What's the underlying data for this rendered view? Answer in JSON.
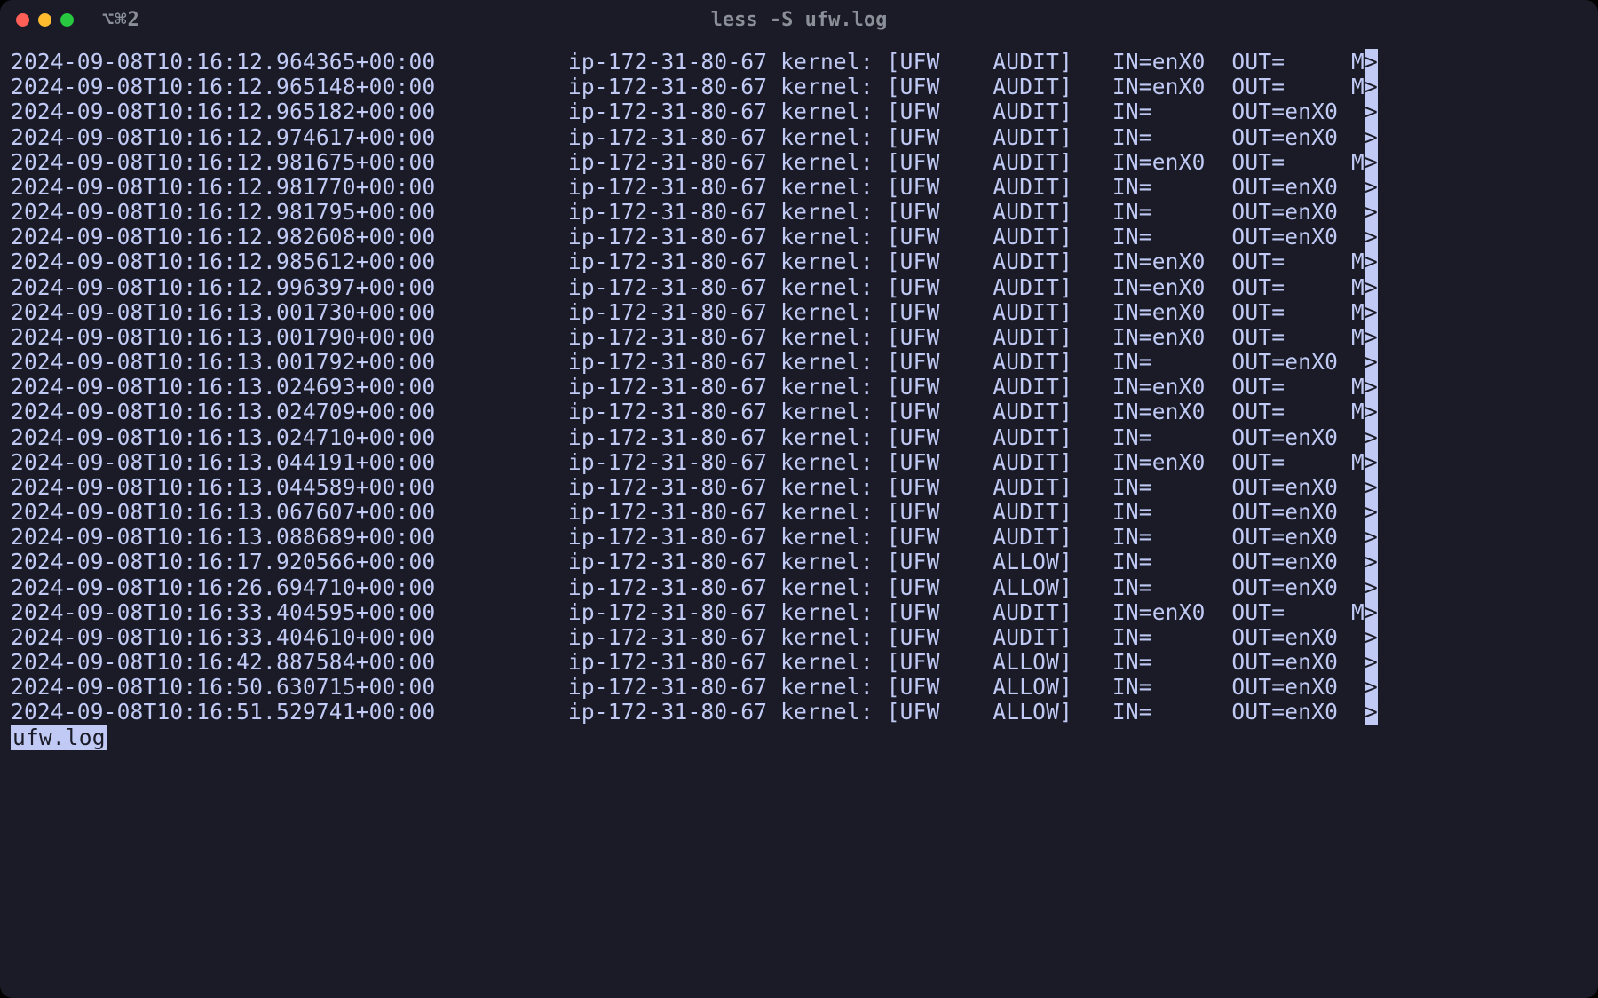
{
  "window": {
    "tab_hint": "⌥⌘2",
    "title": "less -S ufw.log"
  },
  "columns": {
    "host": "ip-172-31-80-67",
    "kernel": "kernel:",
    "ufw": "[UFW",
    "close": "]"
  },
  "rows": [
    {
      "ts": "2024-09-08T10:16:12.964365+00:00",
      "action": "AUDIT",
      "in": "enX0",
      "out": "",
      "tail": "M"
    },
    {
      "ts": "2024-09-08T10:16:12.965148+00:00",
      "action": "AUDIT",
      "in": "enX0",
      "out": "",
      "tail": "M"
    },
    {
      "ts": "2024-09-08T10:16:12.965182+00:00",
      "action": "AUDIT",
      "in": "",
      "out": "enX0",
      "tail": " "
    },
    {
      "ts": "2024-09-08T10:16:12.974617+00:00",
      "action": "AUDIT",
      "in": "",
      "out": "enX0",
      "tail": " "
    },
    {
      "ts": "2024-09-08T10:16:12.981675+00:00",
      "action": "AUDIT",
      "in": "enX0",
      "out": "",
      "tail": "M"
    },
    {
      "ts": "2024-09-08T10:16:12.981770+00:00",
      "action": "AUDIT",
      "in": "",
      "out": "enX0",
      "tail": " "
    },
    {
      "ts": "2024-09-08T10:16:12.981795+00:00",
      "action": "AUDIT",
      "in": "",
      "out": "enX0",
      "tail": " "
    },
    {
      "ts": "2024-09-08T10:16:12.982608+00:00",
      "action": "AUDIT",
      "in": "",
      "out": "enX0",
      "tail": " "
    },
    {
      "ts": "2024-09-08T10:16:12.985612+00:00",
      "action": "AUDIT",
      "in": "enX0",
      "out": "",
      "tail": "M"
    },
    {
      "ts": "2024-09-08T10:16:12.996397+00:00",
      "action": "AUDIT",
      "in": "enX0",
      "out": "",
      "tail": "M"
    },
    {
      "ts": "2024-09-08T10:16:13.001730+00:00",
      "action": "AUDIT",
      "in": "enX0",
      "out": "",
      "tail": "M"
    },
    {
      "ts": "2024-09-08T10:16:13.001790+00:00",
      "action": "AUDIT",
      "in": "enX0",
      "out": "",
      "tail": "M"
    },
    {
      "ts": "2024-09-08T10:16:13.001792+00:00",
      "action": "AUDIT",
      "in": "",
      "out": "enX0",
      "tail": " "
    },
    {
      "ts": "2024-09-08T10:16:13.024693+00:00",
      "action": "AUDIT",
      "in": "enX0",
      "out": "",
      "tail": "M"
    },
    {
      "ts": "2024-09-08T10:16:13.024709+00:00",
      "action": "AUDIT",
      "in": "enX0",
      "out": "",
      "tail": "M"
    },
    {
      "ts": "2024-09-08T10:16:13.024710+00:00",
      "action": "AUDIT",
      "in": "",
      "out": "enX0",
      "tail": " "
    },
    {
      "ts": "2024-09-08T10:16:13.044191+00:00",
      "action": "AUDIT",
      "in": "enX0",
      "out": "",
      "tail": "M"
    },
    {
      "ts": "2024-09-08T10:16:13.044589+00:00",
      "action": "AUDIT",
      "in": "",
      "out": "enX0",
      "tail": " "
    },
    {
      "ts": "2024-09-08T10:16:13.067607+00:00",
      "action": "AUDIT",
      "in": "",
      "out": "enX0",
      "tail": " "
    },
    {
      "ts": "2024-09-08T10:16:13.088689+00:00",
      "action": "AUDIT",
      "in": "",
      "out": "enX0",
      "tail": " "
    },
    {
      "ts": "2024-09-08T10:16:17.920566+00:00",
      "action": "ALLOW",
      "in": "",
      "out": "enX0",
      "tail": " "
    },
    {
      "ts": "2024-09-08T10:16:26.694710+00:00",
      "action": "ALLOW",
      "in": "",
      "out": "enX0",
      "tail": " "
    },
    {
      "ts": "2024-09-08T10:16:33.404595+00:00",
      "action": "AUDIT",
      "in": "enX0",
      "out": "",
      "tail": "M"
    },
    {
      "ts": "2024-09-08T10:16:33.404610+00:00",
      "action": "AUDIT",
      "in": "",
      "out": "enX0",
      "tail": " "
    },
    {
      "ts": "2024-09-08T10:16:42.887584+00:00",
      "action": "ALLOW",
      "in": "",
      "out": "enX0",
      "tail": " "
    },
    {
      "ts": "2024-09-08T10:16:50.630715+00:00",
      "action": "ALLOW",
      "in": "",
      "out": "enX0",
      "tail": " "
    },
    {
      "ts": "2024-09-08T10:16:51.529741+00:00",
      "action": "ALLOW",
      "in": "",
      "out": "enX0",
      "tail": " "
    }
  ],
  "status_line": "ufw.log",
  "truncation_char": ">"
}
